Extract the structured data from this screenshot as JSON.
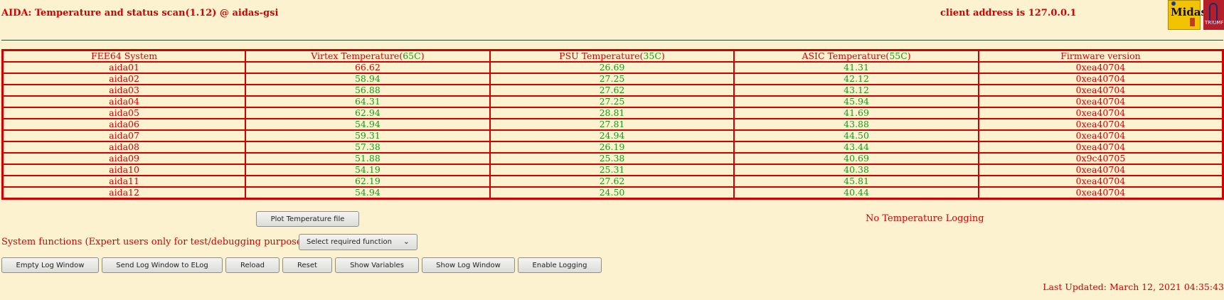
{
  "header": {
    "title": "AIDA: Temperature and status scan(1.12) @ aidas-gsi",
    "client_address": "client address is 127.0.0.1",
    "logo_midas_text": "Midas",
    "logo_triumf_text": "TRIUMF"
  },
  "table": {
    "headers": {
      "system": "FEE64 System",
      "virtex": "Virtex Temperature(",
      "virtex_limit": "65C",
      "psu": "PSU Temperature(",
      "psu_limit": "35C",
      "asic": "ASIC Temperature(",
      "asic_limit": "55C",
      "firmware": "Firmware version",
      "close_paren": ")"
    },
    "rows": [
      {
        "system": "aida01",
        "virtex": "66.62",
        "psu": "26.69",
        "asic": "41.31",
        "firmware": "0xea40704"
      },
      {
        "system": "aida02",
        "virtex": "58.94",
        "psu": "27.25",
        "asic": "42.12",
        "firmware": "0xea40704"
      },
      {
        "system": "aida03",
        "virtex": "56.88",
        "psu": "27.62",
        "asic": "43.12",
        "firmware": "0xea40704"
      },
      {
        "system": "aida04",
        "virtex": "64.31",
        "psu": "27.25",
        "asic": "45.94",
        "firmware": "0xea40704"
      },
      {
        "system": "aida05",
        "virtex": "62.94",
        "psu": "28.81",
        "asic": "41.69",
        "firmware": "0xea40704"
      },
      {
        "system": "aida06",
        "virtex": "54.94",
        "psu": "27.81",
        "asic": "43.88",
        "firmware": "0xea40704"
      },
      {
        "system": "aida07",
        "virtex": "59.31",
        "psu": "24.94",
        "asic": "44.50",
        "firmware": "0xea40704"
      },
      {
        "system": "aida08",
        "virtex": "57.38",
        "psu": "26.19",
        "asic": "43.44",
        "firmware": "0xea40704"
      },
      {
        "system": "aida09",
        "virtex": "51.88",
        "psu": "25.38",
        "asic": "40.69",
        "firmware": "0x9c40705"
      },
      {
        "system": "aida10",
        "virtex": "54.19",
        "psu": "25.31",
        "asic": "40.38",
        "firmware": "0xea40704"
      },
      {
        "system": "aida11",
        "virtex": "62.19",
        "psu": "27.62",
        "asic": "45.81",
        "firmware": "0xea40704"
      },
      {
        "system": "aida12",
        "virtex": "54.94",
        "psu": "24.50",
        "asic": "40.44",
        "firmware": "0xea40704"
      }
    ]
  },
  "plot_button": "Plot Temperature file",
  "temperature_logging_status": "No Temperature Logging",
  "system_functions": {
    "label": "System functions (Expert users only for test/debugging purposes!!!)",
    "select_value": "Select required function"
  },
  "buttons": {
    "empty_log": "Empty Log Window",
    "send_elog": "Send Log Window to ELog",
    "reload": "Reload",
    "reset": "Reset",
    "show_variables": "Show Variables",
    "show_log": "Show Log Window",
    "enable_logging": "Enable Logging"
  },
  "last_updated": "Last Updated: March 12, 2021 04:35:43",
  "colors": {
    "background": "#fdf2d0",
    "text_red": "#d40000",
    "value_green": "#1a9a1a"
  }
}
